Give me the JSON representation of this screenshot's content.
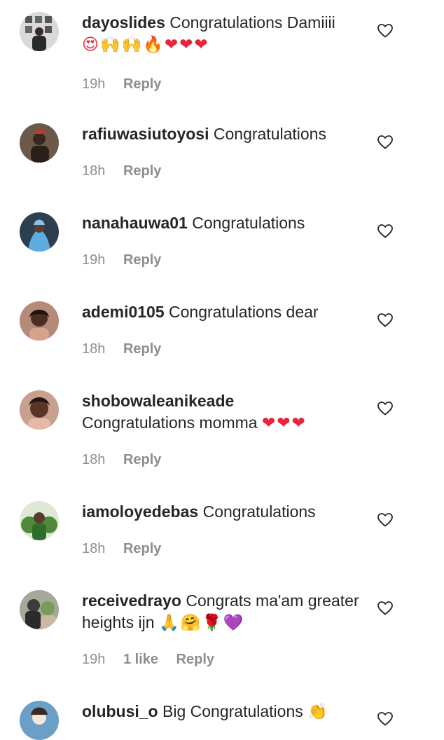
{
  "comments": [
    {
      "username": "dayoslides",
      "text": "Congratulations Damiiii",
      "emoji": "😍🙌🙌🔥❤❤❤",
      "time": "19h",
      "likes": "",
      "reply": "Reply",
      "heart_icon": "heart-outline-icon",
      "avatar_color": "#3a3a3a"
    },
    {
      "username": "rafiuwasiutoyosi",
      "text": "Congratulations",
      "emoji": "",
      "time": "18h",
      "likes": "",
      "reply": "Reply",
      "heart_icon": "heart-outline-icon",
      "avatar_color": "#5a3b3b"
    },
    {
      "username": "nanahauwa01",
      "text": "Congratulations",
      "emoji": "",
      "time": "19h",
      "likes": "",
      "reply": "Reply",
      "heart_icon": "heart-outline-icon",
      "avatar_color": "#3e7fa8"
    },
    {
      "username": "ademi0105",
      "text": "Congratulations dear",
      "emoji": "",
      "time": "18h",
      "likes": "",
      "reply": "Reply",
      "heart_icon": "heart-outline-icon",
      "avatar_color": "#7a4a3a"
    },
    {
      "username": "shobowaleanikeade",
      "text": "Congratulations momma",
      "emoji": "❤❤❤",
      "time": "18h",
      "likes": "",
      "reply": "Reply",
      "heart_icon": "heart-outline-icon",
      "avatar_color": "#9c6b5a"
    },
    {
      "username": "iamoloyedebas",
      "text": "Congratulations",
      "emoji": "",
      "time": "18h",
      "likes": "",
      "reply": "Reply",
      "heart_icon": "heart-outline-icon",
      "avatar_color": "#4f8a3c"
    },
    {
      "username": "receivedrayo",
      "text": "Congrats ma'am greater heights ijn",
      "emoji": "🙏🤗🌹💜",
      "time": "19h",
      "likes": "1 like",
      "reply": "Reply",
      "heart_icon": "heart-outline-icon",
      "avatar_color": "#8a8a7a"
    },
    {
      "username": "olubusi_o",
      "text": "Big Congratulations",
      "emoji": "👏",
      "time": "",
      "likes": "",
      "reply": "",
      "heart_icon": "heart-outline-icon",
      "avatar_color": "#6aa0c8"
    }
  ]
}
